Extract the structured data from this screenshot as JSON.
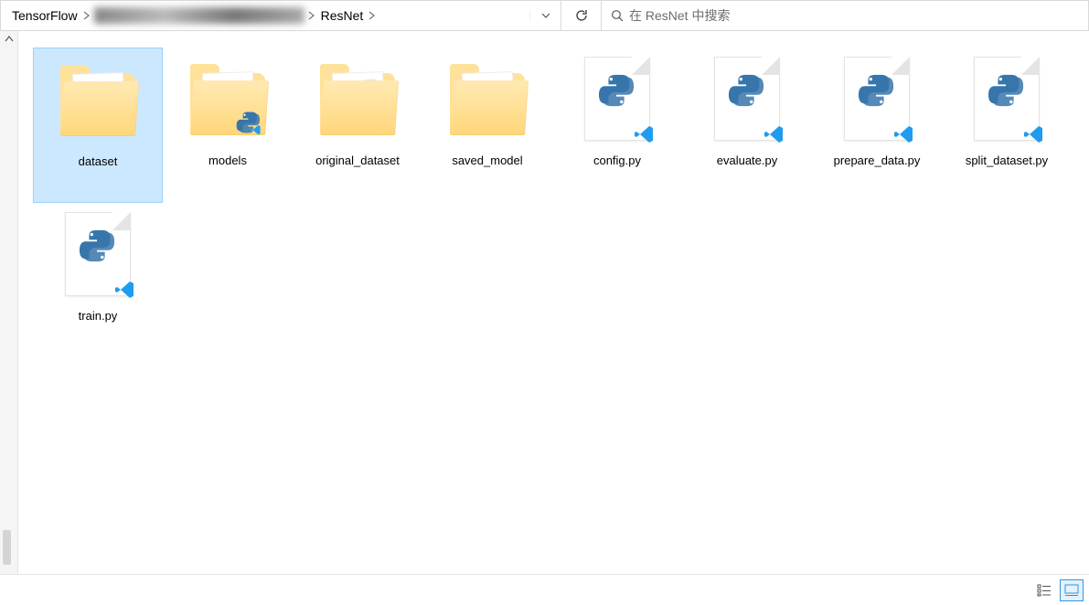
{
  "address_bar": {
    "crumbs": [
      "TensorFlow",
      "ResNet"
    ],
    "obscured_between": true
  },
  "search": {
    "placeholder": "在 ResNet 中搜索"
  },
  "items": [
    {
      "name": "dataset",
      "type": "folder",
      "selected": true
    },
    {
      "name": "models",
      "type": "folder_code",
      "selected": false
    },
    {
      "name": "original_dataset",
      "type": "folder_docs",
      "selected": false
    },
    {
      "name": "saved_model",
      "type": "folder",
      "selected": false
    },
    {
      "name": "config.py",
      "type": "pyfile",
      "selected": false
    },
    {
      "name": "evaluate.py",
      "type": "pyfile",
      "selected": false
    },
    {
      "name": "prepare_data.py",
      "type": "pyfile",
      "selected": false
    },
    {
      "name": "split_dataset.py",
      "type": "pyfile",
      "selected": false
    },
    {
      "name": "train.py",
      "type": "pyfile",
      "selected": false
    }
  ],
  "view_mode": "large_icons"
}
